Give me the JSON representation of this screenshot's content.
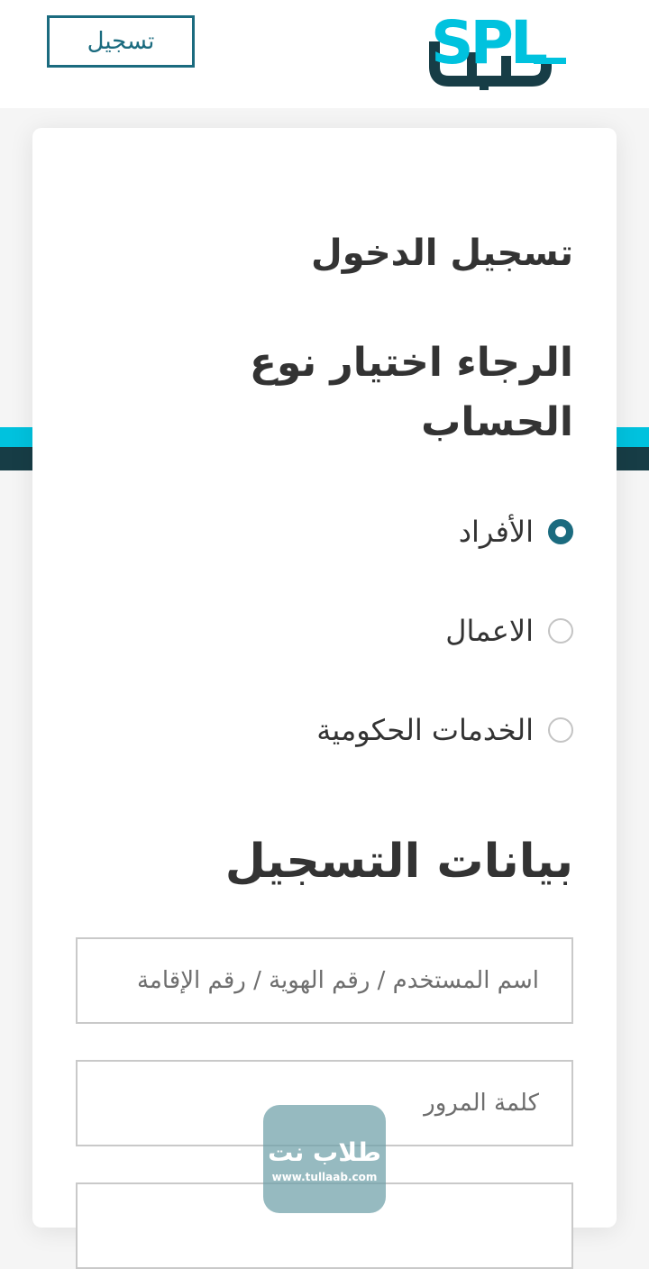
{
  "header": {
    "register_button": "تسجيل",
    "logo_text": "SPL",
    "logo_arabic": "سبل"
  },
  "login_title": "تسجيل الدخول",
  "account_type": {
    "title": "الرجاء اختيار نوع الحساب",
    "options": [
      {
        "label": "الأفراد",
        "selected": true
      },
      {
        "label": "الاعمال",
        "selected": false
      },
      {
        "label": "الخدمات الحكومية",
        "selected": false
      }
    ]
  },
  "registration": {
    "title": "بيانات التسجيل",
    "username_placeholder": "اسم المستخدم / رقم الهوية / رقم الإقامة",
    "password_placeholder": "كلمة المرور"
  },
  "watermark": {
    "text": "طلاب نت",
    "url": "www.tullaab.com"
  },
  "colors": {
    "accent": "#1b6b7f",
    "brand_cyan": "#00c2de",
    "brand_dark": "#173d46"
  }
}
